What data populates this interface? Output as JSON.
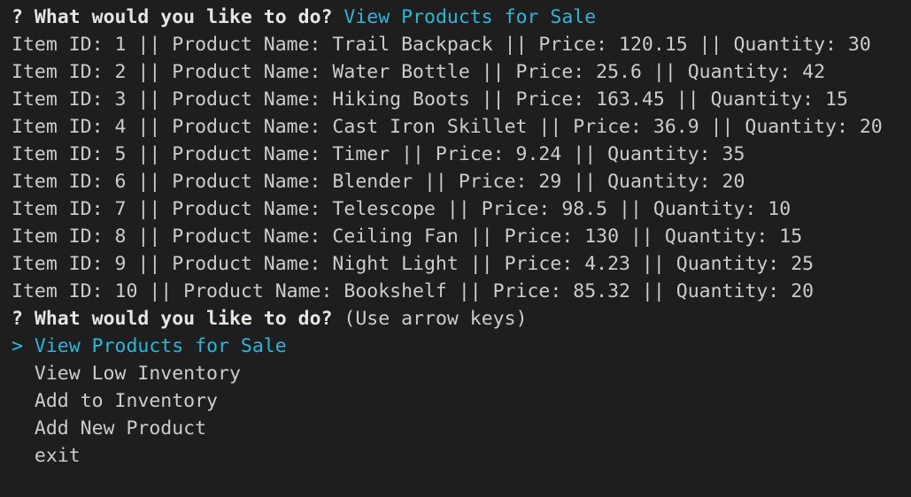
{
  "prompt1": {
    "marker": "?",
    "question": "What would you like to do?",
    "answer": "View Products for Sale"
  },
  "products": [
    {
      "text": "Item ID: 1 || Product Name: Trail Backpack || Price: 120.15 || Quantity: 30"
    },
    {
      "text": "Item ID: 2 || Product Name: Water Bottle || Price: 25.6 || Quantity: 42"
    },
    {
      "text": "Item ID: 3 || Product Name: Hiking Boots || Price: 163.45 || Quantity: 15"
    },
    {
      "text": "Item ID: 4 || Product Name: Cast Iron Skillet || Price: 36.9 || Quantity: 20"
    },
    {
      "text": "Item ID: 5 || Product Name: Timer || Price: 9.24 || Quantity: 35"
    },
    {
      "text": "Item ID: 6 || Product Name: Blender || Price: 29 || Quantity: 20"
    },
    {
      "text": "Item ID: 7 || Product Name: Telescope || Price: 98.5 || Quantity: 10"
    },
    {
      "text": "Item ID: 8 || Product Name: Ceiling Fan || Price: 130 || Quantity: 15"
    },
    {
      "text": "Item ID: 9 || Product Name: Night Light || Price: 4.23 || Quantity: 25"
    },
    {
      "text": "Item ID: 10 || Product Name: Bookshelf || Price: 85.32 || Quantity: 20"
    }
  ],
  "prompt2": {
    "marker": "?",
    "question": "What would you like to do?",
    "hint": "(Use arrow keys)"
  },
  "menu": {
    "pointer": ">",
    "choices": [
      {
        "label": "View Products for Sale"
      },
      {
        "label": "View Low Inventory"
      },
      {
        "label": "Add to Inventory"
      },
      {
        "label": "Add New Product"
      },
      {
        "label": "exit"
      }
    ]
  },
  "colors": {
    "background": "#1e1e1e",
    "text": "#cccccc",
    "prompt_marker": "#23d18b",
    "highlight": "#29b8db"
  }
}
